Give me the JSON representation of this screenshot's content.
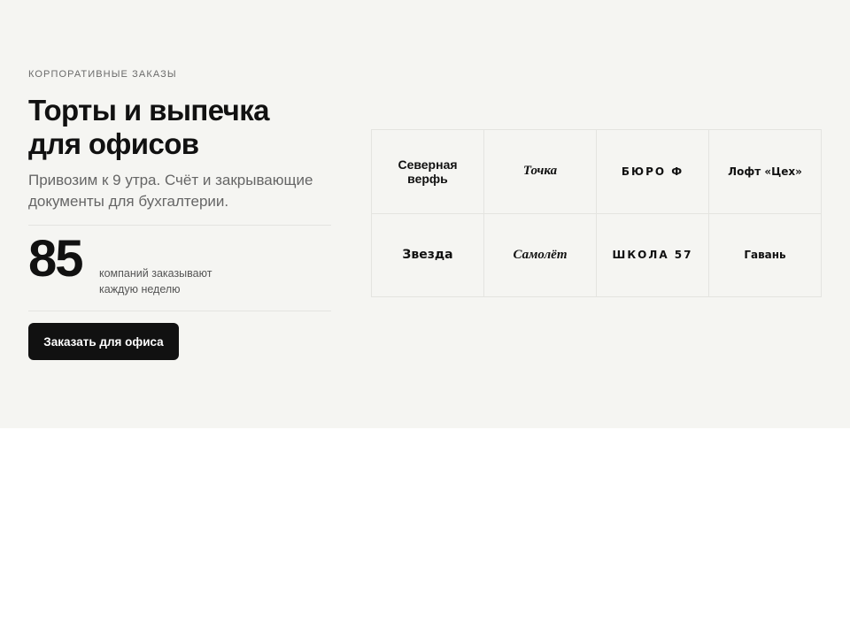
{
  "hero": {
    "eyebrow": "КОРПОРАТИВНЫЕ ЗАКАЗЫ",
    "title_line1": "Торты и выпечка",
    "title_line2": "для офисов",
    "subtitle_line1": "Привозим к 9 утра. Счёт и закрывающие",
    "subtitle_line2": "документы для бухгалтерии.",
    "stat_value": "85",
    "stat_caption_line1": "компаний заказывают",
    "stat_caption_line2": "каждую неделю",
    "cta_label": "Заказать для офиса"
  },
  "client_logos": [
    {
      "line1": "Северная",
      "line2": "верфь"
    },
    {
      "line1": "Точка"
    },
    {
      "line1": "БЮРО Ф"
    },
    {
      "line1": "Лофт «Цех»"
    },
    {
      "line1": "Звезда"
    },
    {
      "line1": "Самолёт"
    },
    {
      "line1": "ШКОЛА 57"
    },
    {
      "line1": "Гавань"
    }
  ],
  "colors": {
    "section_bg": "#f5f5f2",
    "page_bg": "#ffffff",
    "button_bg": "#111111",
    "button_text": "#ffffff",
    "text_primary": "#111111",
    "text_muted": "#666666",
    "divider": "#e4e4e0"
  }
}
